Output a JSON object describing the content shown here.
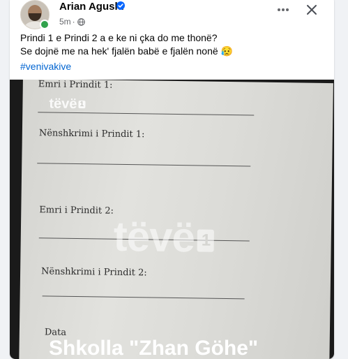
{
  "post": {
    "author": "Arian Agushi",
    "time": "5m",
    "separator": "·",
    "text_line1": "Prindi 1 e Prindi 2 a e ke ni çka do me thonë?",
    "text_line2": "Se dojnë me na hek' fjalën babë e fjalën nonë 😥",
    "hashtag": "#venivakive"
  },
  "icons": {
    "verified": "verified-badge-icon",
    "privacy": "globe-icon",
    "more": "more-options-icon",
    "close": "close-icon"
  },
  "media": {
    "labels": {
      "emri1": "Emri i Prindit 1:",
      "nenshkrimi1": "Nënshkrimi i Prindit 1:",
      "emri2": "Emri i Prindit 2:",
      "nenshkrimi2": "Nënshkrimi i Prindit 2:",
      "data": "Data"
    },
    "watermark": "tëvë",
    "watermark_badge": "1",
    "caption": "Shkolla \"Zhan Göhe\""
  },
  "colors": {
    "accent": "#0866ff",
    "hashtag": "#0064d1",
    "online": "#31a24c"
  }
}
